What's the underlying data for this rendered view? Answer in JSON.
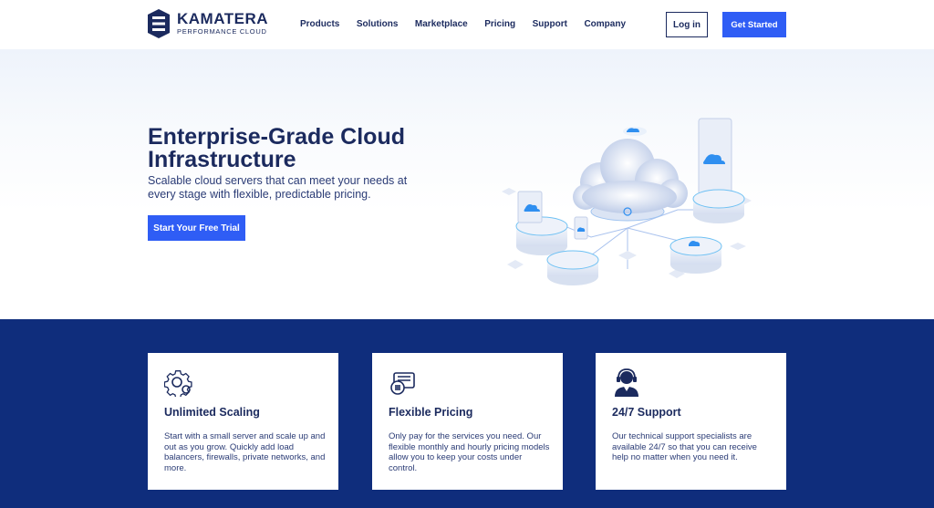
{
  "brand": {
    "name": "KAMATERA",
    "tagline": "PERFORMANCE CLOUD",
    "color": "#1b2a5e",
    "accent": "#2f5df5",
    "band_color": "#0f2d7c"
  },
  "nav": {
    "items": [
      {
        "label": "Products"
      },
      {
        "label": "Solutions"
      },
      {
        "label": "Marketplace"
      },
      {
        "label": "Pricing"
      },
      {
        "label": "Support"
      },
      {
        "label": "Company"
      }
    ],
    "login_label": "Log in",
    "get_started_label": "Get Started"
  },
  "hero": {
    "title": "Enterprise-Grade Cloud Infrastructure",
    "subtitle": "Scalable cloud servers that can meet your needs at every stage with flexible, predictable pricing.",
    "cta_label": "Start Your Free Trial"
  },
  "features": [
    {
      "icon": "gear-icon",
      "title": "Unlimited Scaling",
      "text": "Start with a small server and scale up and out as you grow. Quickly add load balancers, firewalls, private networks, and more."
    },
    {
      "icon": "wallet-icon",
      "title": "Flexible Pricing",
      "text": "Only pay for the services you need. Our flexible monthly and hourly pricing models allow you to keep your costs under control."
    },
    {
      "icon": "headset-agent-icon",
      "title": "24/7 Support",
      "text": "Our technical support specialists are available 24/7 so that you can receive help no matter when you need it."
    }
  ]
}
